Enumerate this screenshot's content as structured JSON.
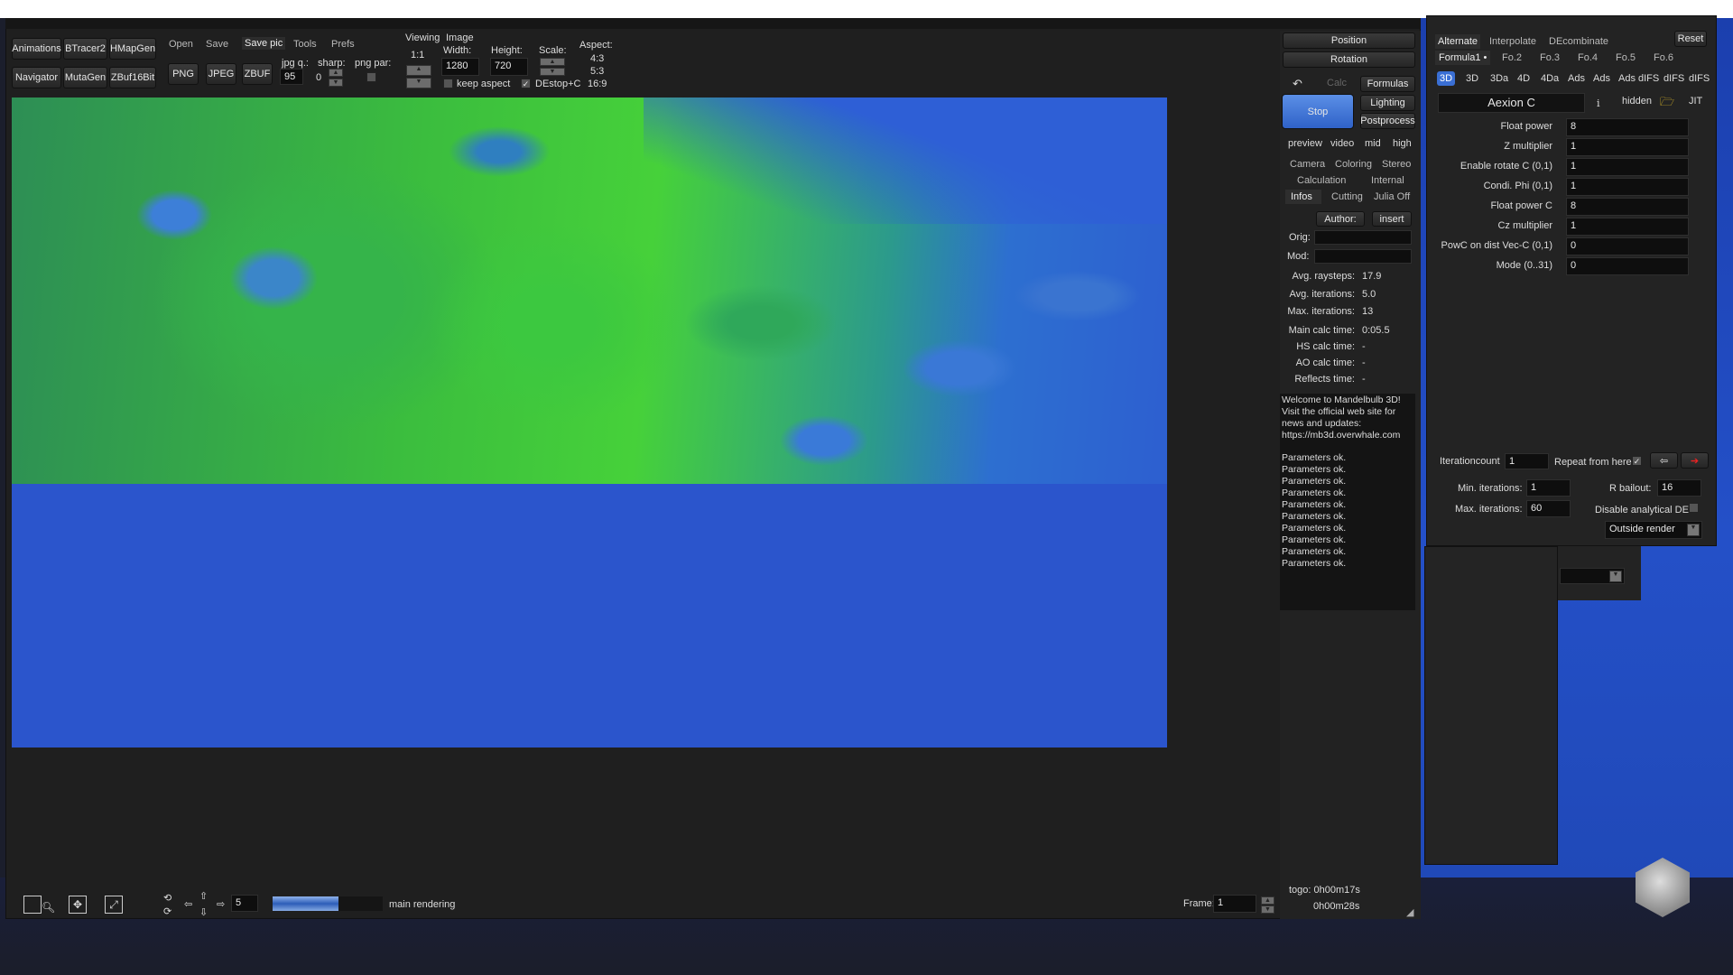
{
  "toolbar": {
    "buttons": [
      "Animations",
      "BTracer2",
      "HMapGen",
      "Navigator",
      "MutaGen",
      "ZBuf16Bit"
    ],
    "menu": [
      "Open",
      "Save",
      "Save pic",
      "Tools",
      "Prefs"
    ],
    "export": [
      "PNG",
      "JPEG",
      "ZBUF"
    ],
    "jpg_q_label": "jpg q.:",
    "jpg_q": "95",
    "sharp_label": "sharp:",
    "sharp": "0",
    "png_par_label": "png par:",
    "viewing_label": "Viewing",
    "viewing_value": "1:1",
    "image_label": "Image",
    "width_label": "Width:",
    "width": "1280",
    "height_label": "Height:",
    "height": "720",
    "scale_label": "Scale:",
    "aspect_label": "Aspect:",
    "aspects": [
      "4:3",
      "5:3",
      "16:9"
    ],
    "keep_aspect": "keep aspect",
    "destop": "DEstop+C",
    "destop_checked": true,
    "keep_aspect_checked": false
  },
  "panel": {
    "position": "Position",
    "rotation": "Rotation",
    "calc": "Calc",
    "formulas": "Formulas",
    "stop": "Stop",
    "lighting": "Lighting",
    "postprocess": "Postprocess",
    "quality": [
      "preview",
      "video",
      "mid",
      "high"
    ],
    "tabs1": [
      "Camera",
      "Coloring",
      "Stereo"
    ],
    "tabs2": [
      "Calculation",
      "Internal"
    ],
    "tabs3": [
      "Infos",
      "Cutting",
      "Julia Off"
    ],
    "author": "Author:",
    "insert": "insert",
    "orig": "Orig:",
    "mod": "Mod:",
    "stats": [
      {
        "label": "Avg. raysteps:",
        "value": "17.9"
      },
      {
        "label": "Avg. iterations:",
        "value": "5.0"
      },
      {
        "label": "Max. iterations:",
        "value": "13"
      },
      {
        "label": "Main calc time:",
        "value": "0:05.5"
      },
      {
        "label": "HS calc time:",
        "value": "-"
      },
      {
        "label": "AO calc time:",
        "value": "-"
      },
      {
        "label": "Reflects time:",
        "value": "-"
      }
    ],
    "welcome": [
      "Welcome to Mandelbulb 3D!",
      "Visit the official web site for",
      "news and updates:",
      "https://mb3d.overwhale.com"
    ],
    "log": [
      "Parameters ok.",
      "Parameters ok.",
      "Parameters ok.",
      "Parameters ok.",
      "Parameters ok.",
      "Parameters ok.",
      "Parameters ok.",
      "Parameters ok.",
      "Parameters ok.",
      "Parameters ok."
    ]
  },
  "formulas": {
    "modes": [
      "Alternate",
      "Interpolate",
      "DEcombinate"
    ],
    "reset": "Reset",
    "slots": [
      "Formula1 •",
      "Fo.2",
      "Fo.3",
      "Fo.4",
      "Fo.5",
      "Fo.6"
    ],
    "types": [
      "3D",
      "3D",
      "3Da",
      "4D",
      "4Da",
      "Ads",
      "Ads",
      "Ads",
      "dIFS",
      "dIFS",
      "dIFS"
    ],
    "name": "Aexion C",
    "info": "i",
    "hidden": "hidden",
    "jit": "JIT",
    "params": [
      {
        "label": "Float power",
        "value": "8"
      },
      {
        "label": "Z multiplier",
        "value": "1"
      },
      {
        "label": "Enable rotate C (0,1)",
        "value": "1"
      },
      {
        "label": "Condi. Phi (0,1)",
        "value": "1"
      },
      {
        "label": "Float power C",
        "value": "8"
      },
      {
        "label": "Cz multiplier",
        "value": "1"
      },
      {
        "label": "PowC on dist Vec-C (0,1)",
        "value": "0"
      },
      {
        "label": "Mode (0..31)",
        "value": "0"
      }
    ],
    "iterationcount_label": "Iterationcount",
    "iterationcount": "1",
    "repeat": "Repeat from here",
    "min_it_label": "Min. iterations:",
    "min_it": "1",
    "max_it_label": "Max. iterations:",
    "max_it": "60",
    "bailout_label": "R bailout:",
    "bailout": "16",
    "disable_de": "Disable analytical DE",
    "outside": "Outside render"
  },
  "status": {
    "step": "5",
    "progress": 0.6,
    "task": "main rendering",
    "frame_label": "Frame:",
    "frame": "1",
    "togo": "togo: 0h00m17s",
    "total": "0h00m28s"
  },
  "colors": {
    "accent": "#2f6fd6",
    "background": "#1f1f1f",
    "render_blue": "#2b55cc"
  }
}
